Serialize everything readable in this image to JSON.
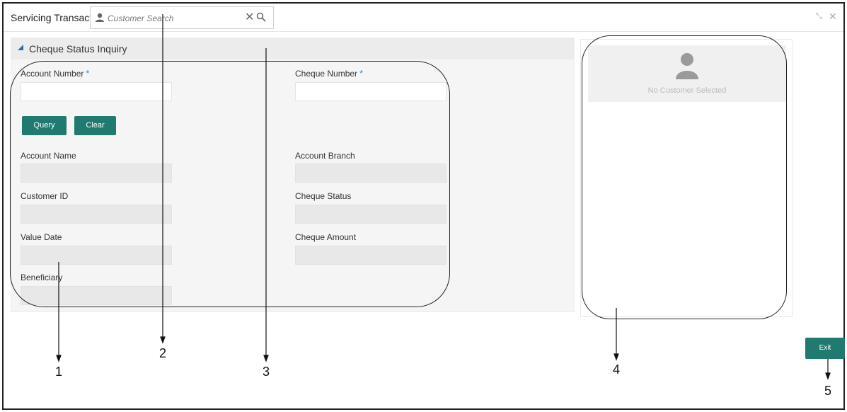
{
  "header": {
    "title": "Servicing Transacti",
    "search_placeholder": "Customer Search"
  },
  "panel": {
    "title": "Cheque Status Inquiry",
    "fields": {
      "account_number_label": "Account Number",
      "cheque_number_label": "Cheque Number",
      "required_marker": "*",
      "account_name_label": "Account Name",
      "account_branch_label": "Account Branch",
      "customer_id_label": "Customer ID",
      "cheque_status_label": "Cheque Status",
      "value_date_label": "Value Date",
      "cheque_amount_label": "Cheque Amount",
      "beneficiary_label": "Beneficiary"
    },
    "buttons": {
      "query": "Query",
      "clear": "Clear"
    }
  },
  "customer_card": {
    "empty_text": "No Customer Selected"
  },
  "footer": {
    "exit_label": "Exit"
  },
  "callouts": [
    "1",
    "2",
    "3",
    "4",
    "5"
  ],
  "icons": [
    "user-icon",
    "clear-icon",
    "search-icon",
    "restore-icon",
    "close-icon",
    "collapse-icon",
    "avatar-icon"
  ],
  "colors": {
    "accent": "#207a70",
    "required": "#2f8fd5"
  }
}
